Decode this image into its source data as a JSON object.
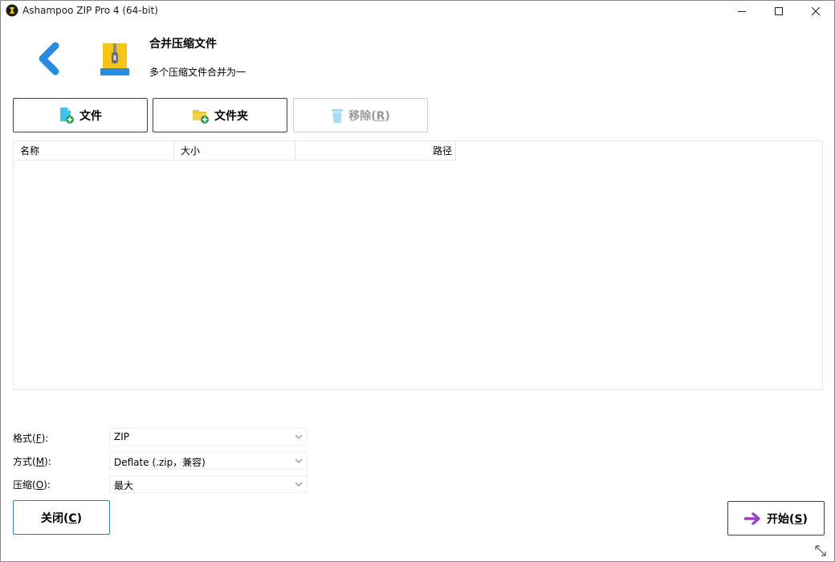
{
  "window": {
    "title": "Ashampoo ZIP Pro 4 (64-bit)"
  },
  "header": {
    "title": "合并压缩文件",
    "subtitle": "多个压缩文件合并为一"
  },
  "toolbar": {
    "file_label": "文件",
    "folder_label": "文件夹",
    "remove_label_main": "移除(",
    "remove_key": "R",
    "remove_label_end": ")"
  },
  "file_list": {
    "columns": [
      "名称",
      "大小",
      "路径"
    ],
    "rows": []
  },
  "options": {
    "format": {
      "label_main": "格式(",
      "key": "F",
      "label_end": "):",
      "value": "ZIP"
    },
    "method": {
      "label_main": "方式(",
      "key": "M",
      "label_end": "):",
      "value": "Deflate (.zip，兼容)"
    },
    "compression": {
      "label_main": "压缩(",
      "key": "O",
      "label_end": "):",
      "value": "最大"
    }
  },
  "footer": {
    "close": {
      "label_main": "关闭(",
      "key": "C",
      "label_end": ")"
    },
    "start": {
      "label_main": "开始(",
      "key": "S",
      "label_end": ")"
    }
  },
  "colors": {
    "accent_blue": "#2a8ce0",
    "zip_yellow": "#f5c518",
    "start_arrow": "#9b3fc9",
    "close_border": "#2c7fd4"
  }
}
